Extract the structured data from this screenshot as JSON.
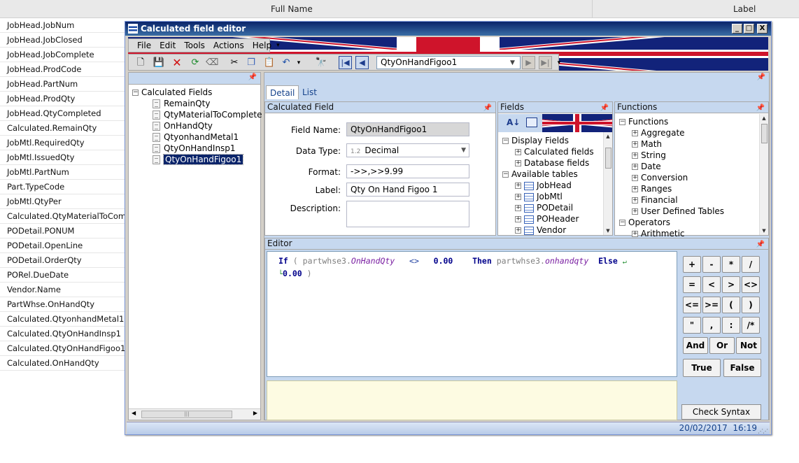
{
  "background": {
    "columns": [
      "Full Name",
      "Label"
    ],
    "rows": [
      "JobHead.JobNum",
      "JobHead.JobClosed",
      "JobHead.JobComplete",
      "JobHead.ProdCode",
      "JobHead.PartNum",
      "JobHead.ProdQty",
      "JobHead.QtyCompleted",
      "Calculated.RemainQty",
      "JobMtl.RequiredQty",
      "JobMtl.IssuedQty",
      "JobMtl.PartNum",
      "Part.TypeCode",
      "JobMtl.QtyPer",
      "Calculated.QtyMaterialToComplete",
      "PODetail.PONUM",
      "PODetail.OpenLine",
      "PODetail.OrderQty",
      "PORel.DueDate",
      "Vendor.Name",
      "PartWhse.OnHandQty",
      "Calculated.QtyonhandMetal1",
      "Calculated.QtyOnHandInsp1",
      "Calculated.QtyOnHandFigoo1",
      "Calculated.OnHandQty"
    ]
  },
  "window": {
    "title": "Calculated field editor",
    "controls": {
      "minimize": "_",
      "maximize": "□",
      "close": "X"
    }
  },
  "menu": [
    "File",
    "Edit",
    "Tools",
    "Actions",
    "Help"
  ],
  "toolbar": {
    "record_combo": "QtyOnHandFigoo1"
  },
  "left_tree": {
    "root": "Calculated Fields",
    "items": [
      "RemainQty",
      "QtyMaterialToComplete",
      "OnHandQty",
      "QtyonhandMetal1",
      "QtyOnHandInsp1",
      "QtyOnHandFigoo1"
    ],
    "selected": "QtyOnHandFigoo1"
  },
  "tabs": [
    "Detail",
    "List"
  ],
  "calculated_field": {
    "header": "Calculated Field",
    "field_name_label": "Field Name:",
    "field_name": "QtyOnHandFigoo1",
    "data_type_label": "Data Type:",
    "data_type_prefix": "1.2",
    "data_type": "Decimal",
    "format_label": "Format:",
    "format": "->>,>>9.99",
    "label_label": "Label:",
    "label": "Qty On Hand Figoo 1",
    "description_label": "Description:",
    "description": ""
  },
  "fields_panel": {
    "header": "Fields",
    "display_fields": "Display Fields",
    "display_children": [
      "Calculated fields",
      "Database fields"
    ],
    "available_tables": "Available tables",
    "tables": [
      "JobHead",
      "JobMtl",
      "PODetail",
      "POHeader",
      "Vendor"
    ]
  },
  "functions_panel": {
    "header": "Functions",
    "root": "Functions",
    "items": [
      "Aggregate",
      "Math",
      "String",
      "Date",
      "Conversion",
      "Ranges",
      "Financial",
      "User Defined Tables"
    ],
    "operators": "Operators",
    "operator_child": "Arithmetic"
  },
  "editor": {
    "header": "Editor",
    "line1": {
      "kw_if": "If",
      "paren_open": "(",
      "id1": "partwhse3.",
      "prop1": "OnHandQty",
      "op": "<>",
      "num1": "0.00",
      "kw_then": "Then",
      "id2": "partwhse3.",
      "prop2": "onhandqty",
      "kw_else": "Else"
    },
    "line2": {
      "num2": "0.00",
      "paren_close": ")"
    }
  },
  "keypad": {
    "row1": [
      "+",
      "-",
      "*",
      "/"
    ],
    "row2": [
      "=",
      "<",
      ">",
      "<>"
    ],
    "row3": [
      "<=",
      ">=",
      "(",
      ")"
    ],
    "row4": [
      "\"",
      ",",
      ":",
      "/*"
    ],
    "row5": [
      "And",
      "Or",
      "Not"
    ],
    "row6": [
      "True",
      "False"
    ],
    "check_syntax": "Check Syntax"
  },
  "status": {
    "date": "20/02/2017",
    "time": "16:19"
  },
  "colors": {
    "title_bar": "#0a246a",
    "panel_header": "#c6d8ef",
    "keyword": "#00008b",
    "property": "#7a1fa2"
  }
}
